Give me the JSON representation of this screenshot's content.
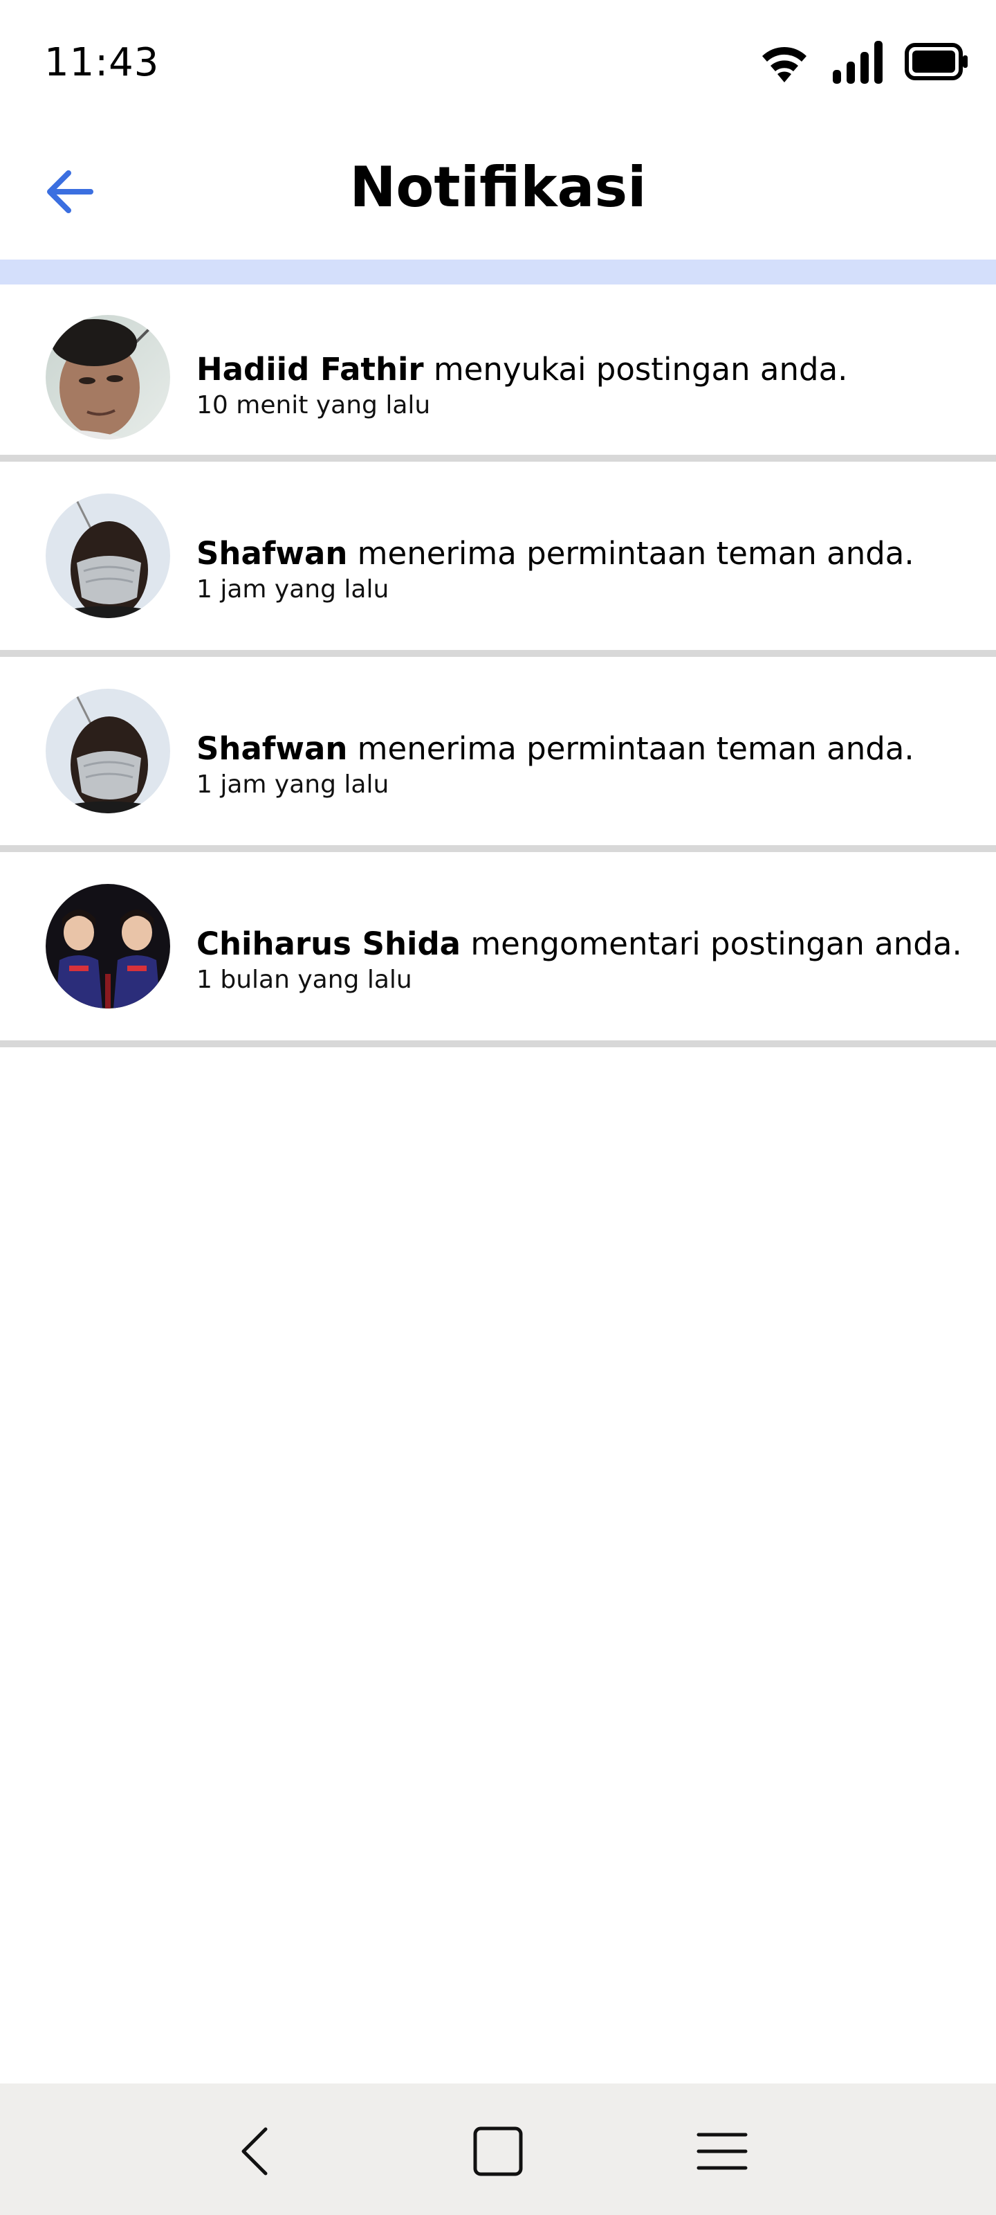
{
  "status_bar": {
    "time": "11:43",
    "icons": [
      "wifi-icon",
      "signal-icon",
      "battery-icon"
    ]
  },
  "header": {
    "title": "Notifikasi",
    "back_icon": "arrow-left-icon",
    "accent_color": "#3b6fe0",
    "band_color": "#d4dffb"
  },
  "notifications": [
    {
      "name": "Hadiid Fathir",
      "message": " menyukai postingan anda.",
      "time": "10 menit yang lalu"
    },
    {
      "name": "Shafwan",
      "message": " menerima permintaan teman anda.",
      "time": "1 jam yang lalu"
    },
    {
      "name": "Shafwan",
      "message": " menerima permintaan teman anda.",
      "time": "1 jam yang lalu"
    },
    {
      "name": "Chiharus Shida",
      "message": " mengomentari postingan anda.",
      "time": "1 bulan yang lalu"
    }
  ],
  "nav_bar": {
    "icons": [
      "nav-back-icon",
      "nav-home-icon",
      "nav-menu-icon"
    ]
  }
}
